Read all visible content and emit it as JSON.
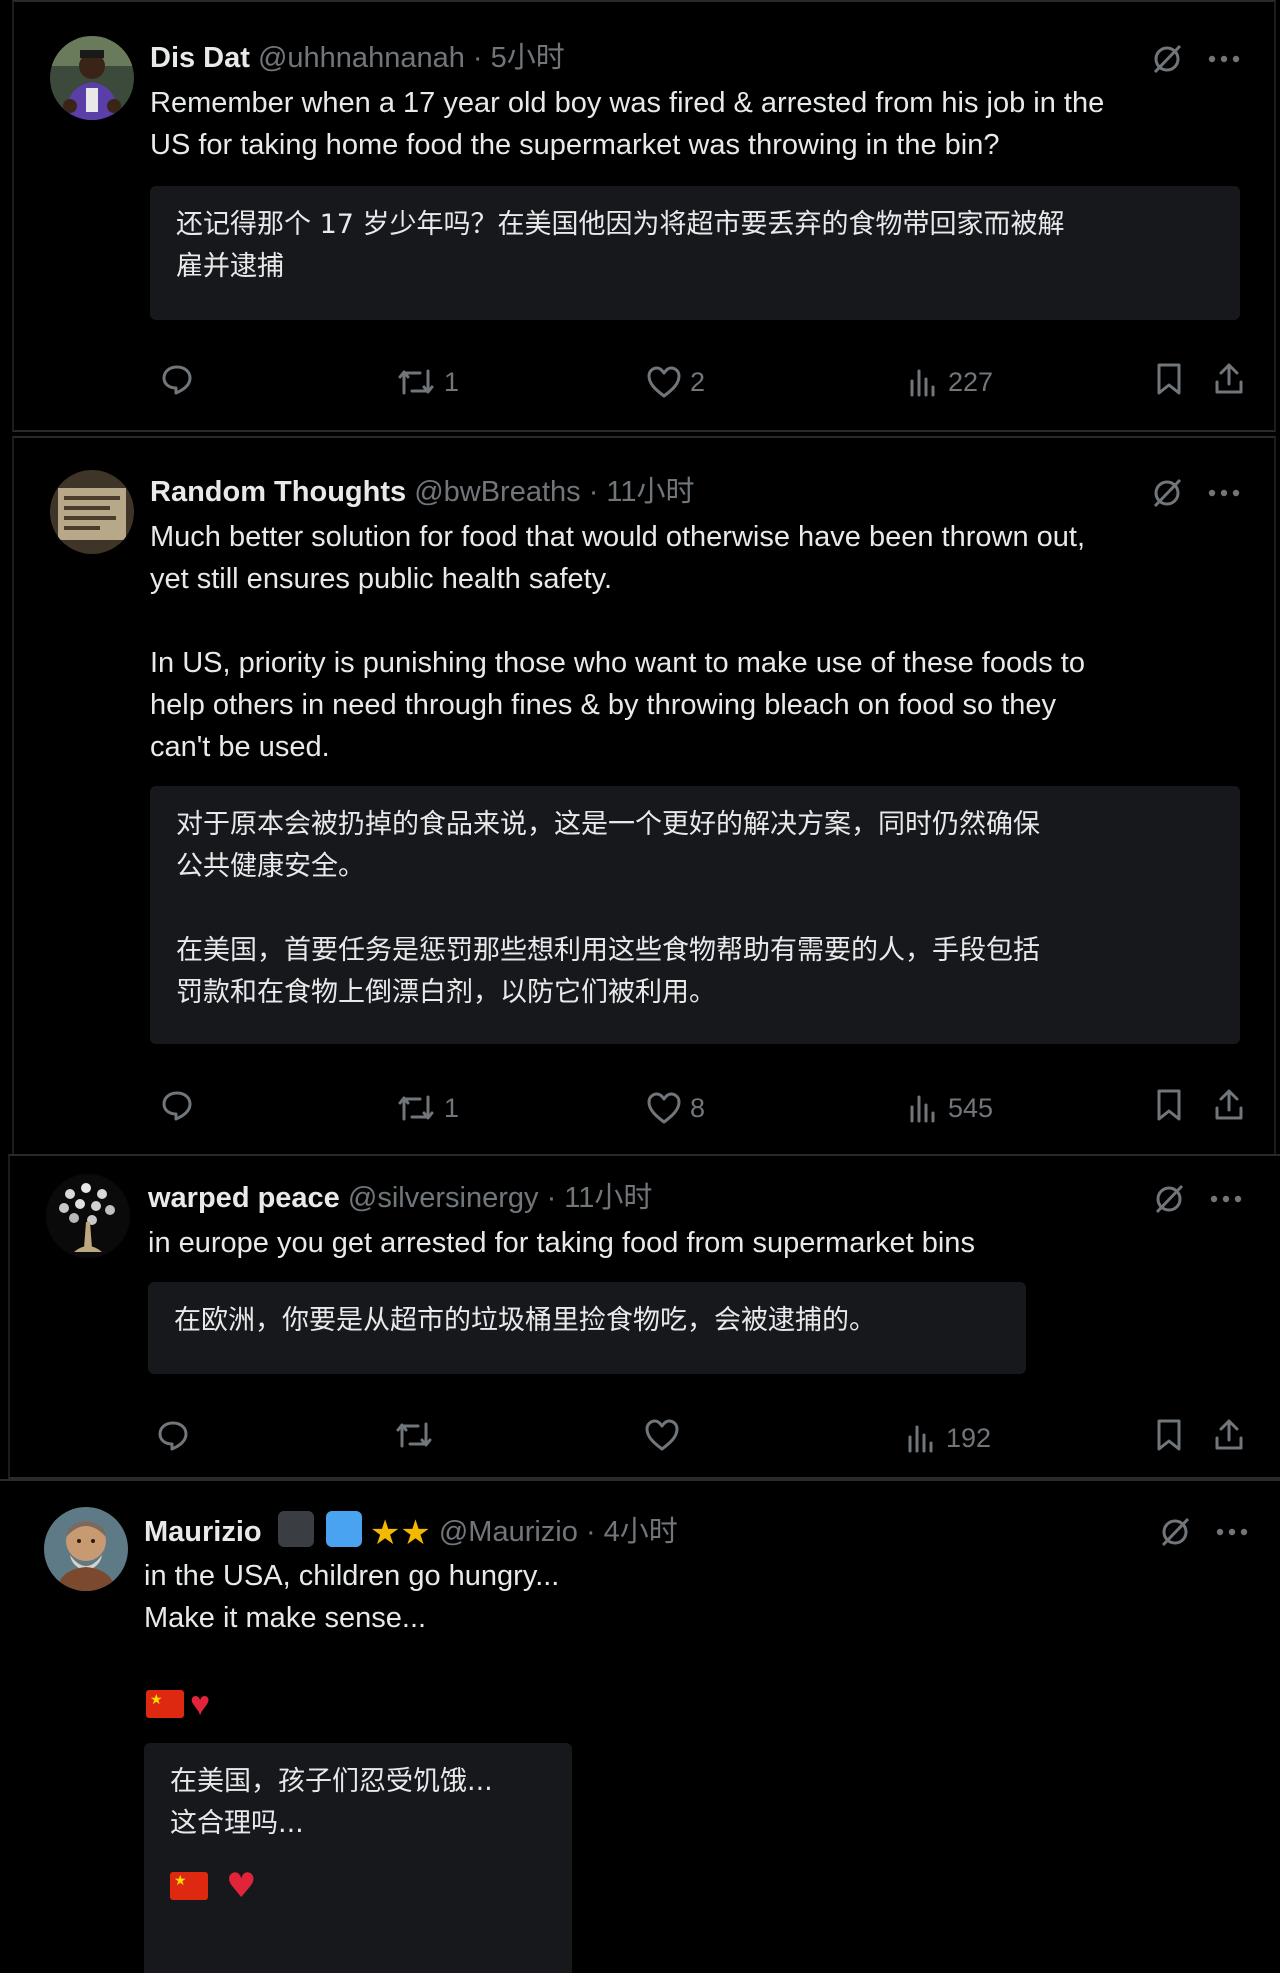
{
  "posts": [
    {
      "author": "Dis Dat",
      "handle": "@uhhnahnanah",
      "time": "· 5小时",
      "text": [
        "Remember when a 17 year old boy was fired & arrested from his job in the",
        "US for taking home food the supermarket was throwing in the bin?"
      ],
      "translation": [
        "还记得那个 17 岁少年吗？在美国他因为将超市要丢弃的食物带回家而被解",
        "雇并逮捕"
      ],
      "stats": {
        "replies": "",
        "reposts": "1",
        "likes": "2",
        "views": "227"
      }
    },
    {
      "author": "Random Thoughts",
      "handle": "@bwBreaths",
      "time": "· 11小时",
      "text": [
        "Much better solution for food that would otherwise have been thrown out,",
        "yet still ensures public health safety.",
        "",
        "In US, priority is punishing those who want to make use of these foods to",
        "help others in need through fines & by throwing bleach on food so they",
        "can't be used."
      ],
      "translation": [
        "对于原本会被扔掉的食品来说，这是一个更好的解决方案，同时仍然确保",
        "公共健康安全。",
        "",
        "在美国，首要任务是惩罚那些想利用这些食物帮助有需要的人，手段包括",
        "罚款和在食物上倒漂白剂，以防它们被利用。"
      ],
      "stats": {
        "replies": "",
        "reposts": "1",
        "likes": "8",
        "views": "545"
      }
    },
    {
      "author": "warped peace",
      "handle": "@silversinergy",
      "time": "· 11小时",
      "text": [
        "in europe you get arrested for taking food from supermarket bins"
      ],
      "translation": [
        "在欧洲，你要是从超市的垃圾桶里捡食物吃，会被逮捕的。"
      ],
      "stats": {
        "replies": "",
        "reposts": "",
        "likes": "",
        "views": "192"
      }
    },
    {
      "author": "Maurizio",
      "handle": "@Maurizio",
      "time": "· 4小时",
      "text": [
        "in the USA, children go hungry...",
        "Make it make sense..."
      ],
      "translation": [
        "在美国，孩子们忍受饥饿...",
        "这合理吗..."
      ],
      "badge_colors": [
        "#3a3d42",
        "#4aa3f0"
      ],
      "stats": {}
    }
  ],
  "colors": {
    "background": "#000000",
    "text": "#e7e9ea",
    "muted": "#71767b",
    "translation_bg": "#16181c",
    "heart": "#e0243a",
    "star": "#f5b800"
  },
  "icons": [
    "grok-icon",
    "more-icon",
    "reply-icon",
    "repost-icon",
    "like-icon",
    "views-icon",
    "bookmark-icon",
    "share-icon",
    "flag-cn-emoji",
    "red-heart-emoji",
    "star-emoji"
  ]
}
